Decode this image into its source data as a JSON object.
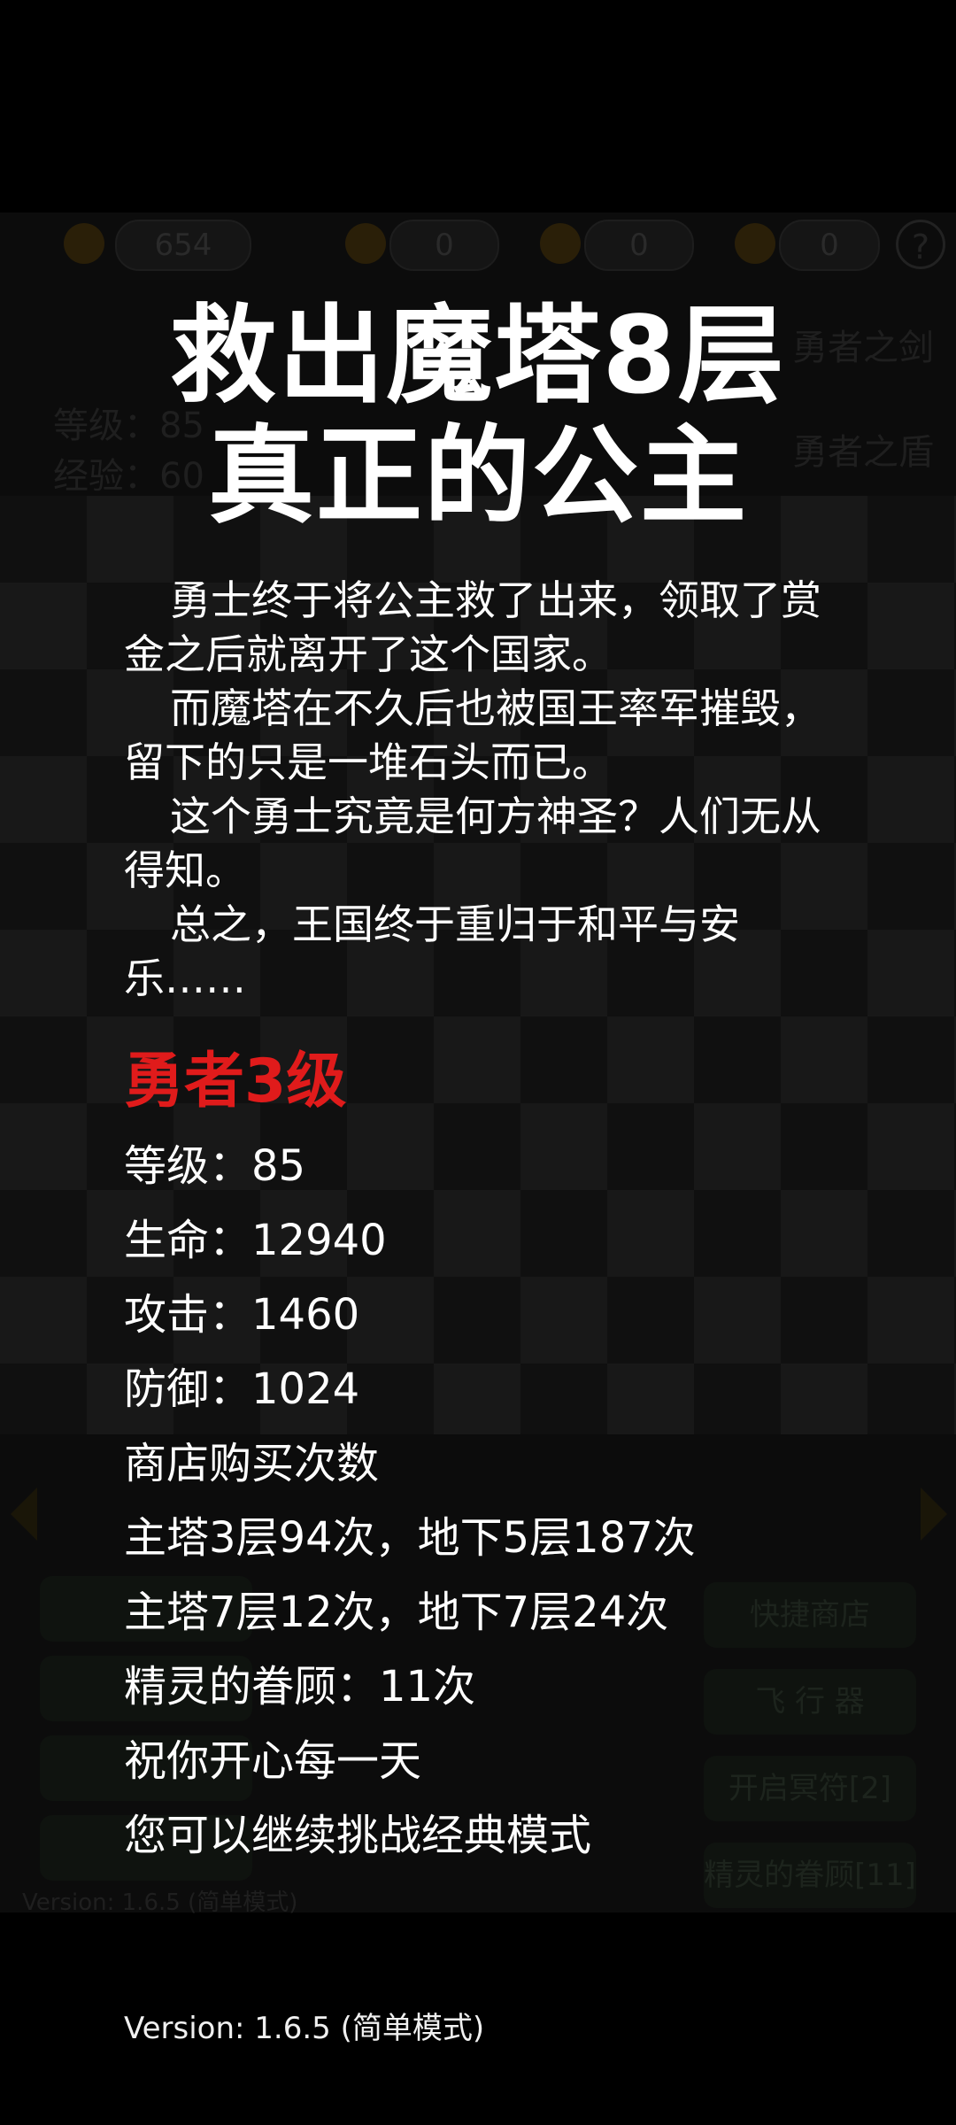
{
  "background": {
    "hud": {
      "gold": "654",
      "yellow_keys": "0",
      "blue_keys": "0",
      "red_keys": "0",
      "help_icon": "question-icon"
    },
    "weapon": "勇者之剑",
    "shield": "勇者之盾",
    "level_label": "等级：85",
    "exp_label": "经验：60",
    "buttons": [
      "快捷商店",
      "飞 行 器",
      "开启冥符[2]",
      "精灵的眷顾[11]"
    ],
    "version_faint": "Version: 1.6.5 (简单模式)"
  },
  "ending": {
    "title_line1": "救出魔塔8层",
    "title_line2": "真正的公主",
    "story": [
      "勇士终于将公主救了出来，领取了赏金之后就离开了这个国家。",
      "而魔塔在不久后也被国王率军摧毁，留下的只是一堆石头而已。",
      "这个勇士究竟是何方神圣？人们无从得知。",
      "总之，王国终于重归于和平与安乐……"
    ],
    "rank": "勇者3级",
    "stats": [
      "等级：85",
      "生命：12940",
      "攻击：1460",
      "防御：1024",
      "商店购买次数",
      "主塔3层94次，地下5层187次",
      "主塔7层12次，地下7层24次",
      "精灵的眷顾：11次",
      "祝你开心每一天",
      "您可以继续挑战经典模式"
    ],
    "version": "Version: 1.6.5 (简单模式)",
    "rank_color": "#e01b1b"
  }
}
